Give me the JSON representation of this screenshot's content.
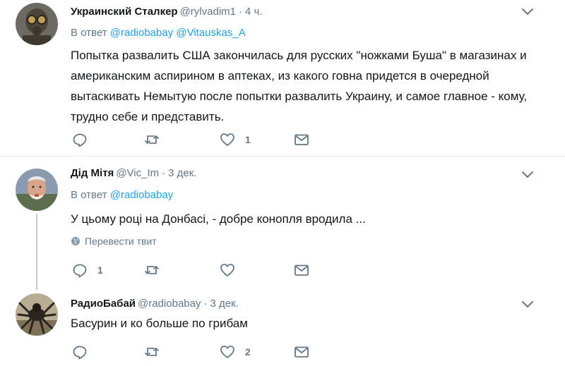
{
  "tweets": [
    {
      "name": "Украинский Сталкер",
      "handle": "@rylvadim1",
      "sep": "·",
      "time": "4 ч.",
      "reply_prefix": "В ответ",
      "mentions": [
        "@radiobabay",
        "@Vitauskas_A"
      ],
      "text": "Попытка развалить США закончилась для русских \"ножками Буша\" в магазинах и американским аспирином в аптеках, из какого говна придется в очередной вытаскивать Немытую после попытки развалить Украину, и самое главное - кому, трудно себе и представить.",
      "reply_count": "",
      "retweet_count": "",
      "like_count": "1"
    },
    {
      "name": "Дід Мітя",
      "handle": "@Vic_Im",
      "sep": "·",
      "time": "3 дек.",
      "reply_prefix": "В ответ",
      "mentions": [
        "@radiobabay"
      ],
      "text": "У цьому році на Донбасі, - добре конопля вродила ...",
      "translate_label": "Перевести твит",
      "reply_count": "1",
      "retweet_count": "",
      "like_count": ""
    },
    {
      "name": "РадиоБабай",
      "handle": "@radiobabay",
      "sep": "·",
      "time": "3 дек.",
      "text": "Басурин и ко больше по грибам",
      "reply_count": "",
      "retweet_count": "",
      "like_count": "2"
    }
  ],
  "icons": {
    "reply": "reply-icon",
    "retweet": "retweet-icon",
    "like": "heart-icon",
    "dm": "envelope-icon",
    "more": "chevron-down-icon",
    "translate": "globe-icon"
  },
  "colors": {
    "link": "#1da1f2",
    "muted": "#657786",
    "text": "#14171a",
    "divider": "#e6ecf0"
  }
}
